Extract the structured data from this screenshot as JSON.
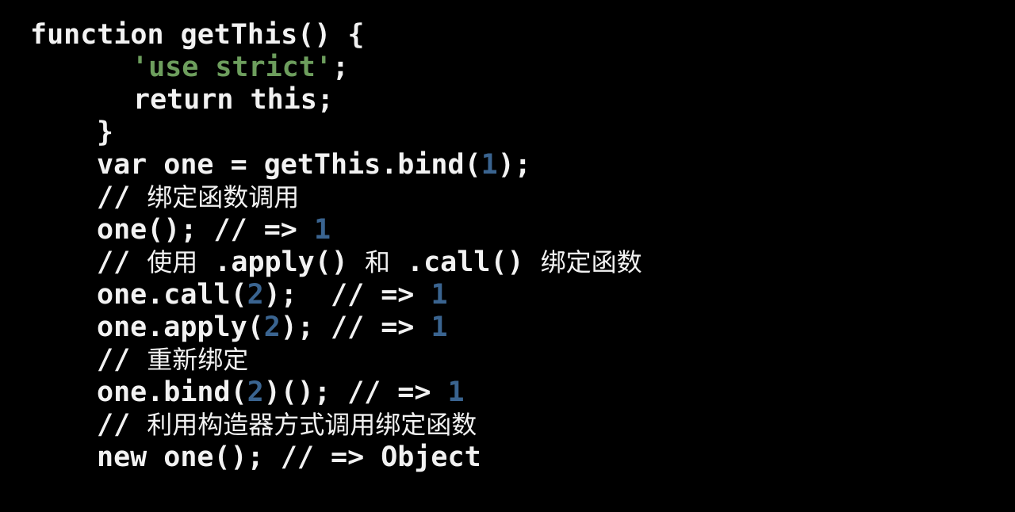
{
  "slide": {
    "background_color": "#000000",
    "language": "javascript",
    "theme": {
      "text_color": "#f2f2f2",
      "string_color": "#6d9e5d",
      "number_color": "#3a6490"
    }
  },
  "code": {
    "lines": [
      {
        "id": "line-1",
        "indent": 38,
        "segments": [
          {
            "kind": "plain",
            "text": "function getThis() {"
          }
        ]
      },
      {
        "id": "line-2",
        "indent": 166,
        "segments": [
          {
            "kind": "string",
            "text": "'use strict'"
          },
          {
            "kind": "plain",
            "text": ";"
          }
        ]
      },
      {
        "id": "line-3",
        "indent": 168,
        "segments": [
          {
            "kind": "plain",
            "text": "return this;"
          }
        ]
      },
      {
        "id": "line-4",
        "indent": 122,
        "segments": [
          {
            "kind": "plain",
            "text": "}"
          }
        ]
      },
      {
        "id": "line-5",
        "indent": 122,
        "segments": [
          {
            "kind": "plain",
            "text": "var one = getThis.bind("
          },
          {
            "kind": "number",
            "text": "1"
          },
          {
            "kind": "plain",
            "text": ");"
          }
        ]
      },
      {
        "id": "line-6",
        "indent": 122,
        "segments": [
          {
            "kind": "plain",
            "text": "// "
          },
          {
            "kind": "cjk",
            "text": "绑定函数调用"
          }
        ]
      },
      {
        "id": "line-7",
        "indent": 122,
        "segments": [
          {
            "kind": "plain",
            "text": "one(); // => "
          },
          {
            "kind": "number",
            "text": "1"
          }
        ]
      },
      {
        "id": "line-8",
        "indent": 122,
        "segments": [
          {
            "kind": "plain",
            "text": "// "
          },
          {
            "kind": "cjk",
            "text": "使用"
          },
          {
            "kind": "plain",
            "text": " .apply() "
          },
          {
            "kind": "cjk",
            "text": "和"
          },
          {
            "kind": "plain",
            "text": " .call() "
          },
          {
            "kind": "cjk",
            "text": "绑定函数"
          }
        ]
      },
      {
        "id": "line-9",
        "indent": 122,
        "segments": [
          {
            "kind": "plain",
            "text": "one.call("
          },
          {
            "kind": "number",
            "text": "2"
          },
          {
            "kind": "plain",
            "text": ");  // => "
          },
          {
            "kind": "number",
            "text": "1"
          }
        ]
      },
      {
        "id": "line-10",
        "indent": 122,
        "segments": [
          {
            "kind": "plain",
            "text": "one.apply("
          },
          {
            "kind": "number",
            "text": "2"
          },
          {
            "kind": "plain",
            "text": "); // => "
          },
          {
            "kind": "number",
            "text": "1"
          }
        ]
      },
      {
        "id": "line-11",
        "indent": 122,
        "segments": [
          {
            "kind": "plain",
            "text": "// "
          },
          {
            "kind": "cjk",
            "text": "重新绑定"
          }
        ]
      },
      {
        "id": "line-12",
        "indent": 122,
        "segments": [
          {
            "kind": "plain",
            "text": "one.bind("
          },
          {
            "kind": "number",
            "text": "2"
          },
          {
            "kind": "plain",
            "text": ")(); // => "
          },
          {
            "kind": "number",
            "text": "1"
          }
        ]
      },
      {
        "id": "line-13",
        "indent": 122,
        "segments": [
          {
            "kind": "plain",
            "text": "// "
          },
          {
            "kind": "cjk",
            "text": "利用构造器方式调用绑定函数"
          }
        ]
      },
      {
        "id": "line-14",
        "indent": 122,
        "segments": [
          {
            "kind": "plain",
            "text": "new one(); // => Object"
          }
        ]
      }
    ]
  }
}
